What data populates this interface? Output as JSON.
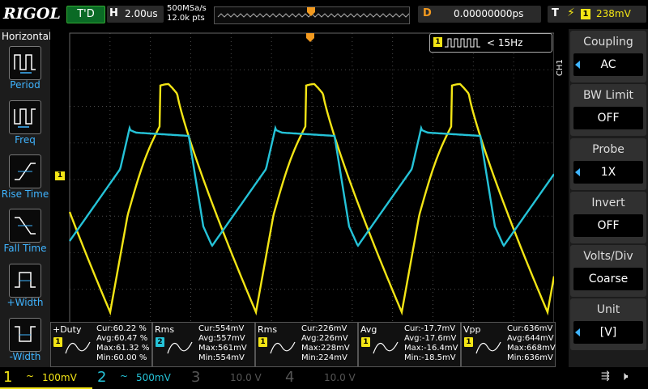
{
  "header": {
    "brand": "RIGOL",
    "trigger_status": "T'D",
    "horizontal_key": "H",
    "timebase": "2.00us",
    "sample_rate": "500MSa/s",
    "memory_depth": "12.0k pts",
    "delay_key": "D",
    "delay": "0.00000000ps",
    "trigger_key": "T",
    "trigger_source": "1",
    "trigger_level": "238mV"
  },
  "left_menu": {
    "title": "Horizontal",
    "items": [
      {
        "label": "Period"
      },
      {
        "label": "Freq"
      },
      {
        "label": "Rise Time"
      },
      {
        "label": "Fall Time"
      },
      {
        "label": "+Width"
      },
      {
        "label": "-Width"
      }
    ]
  },
  "right_menu": {
    "channel_tab": "CH1",
    "groups": [
      {
        "title": "Coupling",
        "value": "AC"
      },
      {
        "title": "BW Limit",
        "value": "OFF"
      },
      {
        "title": "Probe",
        "value": "1X"
      },
      {
        "title": "Invert",
        "value": "OFF"
      },
      {
        "title": "Volts/Div",
        "value": "Coarse"
      },
      {
        "title": "Unit",
        "value": "[V]"
      }
    ]
  },
  "counter": {
    "channel": "1",
    "value": "< 15Hz"
  },
  "channel1_marker": "1",
  "measurements": [
    {
      "name": "+Duty",
      "channel": "1",
      "cur": "Cur:60.22 %",
      "avg": "Avg:60.47 %",
      "max": "Max:61.32 %",
      "min": "Min:60.00 %"
    },
    {
      "name": "Rms",
      "channel": "2",
      "cur": "Cur:554mV",
      "avg": "Avg:557mV",
      "max": "Max:561mV",
      "min": "Min:554mV"
    },
    {
      "name": "Rms",
      "channel": "1",
      "cur": "Cur:226mV",
      "avg": "Avg:226mV",
      "max": "Max:228mV",
      "min": "Min:224mV"
    },
    {
      "name": "Avg",
      "channel": "1",
      "cur": "Cur:-17.7mV",
      "avg": "Avg:-17.6mV",
      "max": "Max:-16.4mV",
      "min": "Min:-18.5mV"
    },
    {
      "name": "Vpp",
      "channel": "1",
      "cur": "Cur:636mV",
      "avg": "Avg:644mV",
      "max": "Max:668mV",
      "min": "Min:636mV"
    }
  ],
  "channels": [
    {
      "num": "1",
      "coupling": "~",
      "scale": "100mV",
      "color": "#f3e515"
    },
    {
      "num": "2",
      "coupling": "~",
      "scale": "500mV",
      "color": "#25c3d8"
    },
    {
      "num": "3",
      "coupling": "",
      "scale": "10.0 V",
      "color": "#555555"
    },
    {
      "num": "4",
      "coupling": "",
      "scale": "10.0 V",
      "color": "#555555"
    }
  ],
  "colors": {
    "ch1": "#f3e515",
    "ch2": "#25c3d8",
    "accent": "#f39a1f",
    "label": "#3fb4ff"
  }
}
